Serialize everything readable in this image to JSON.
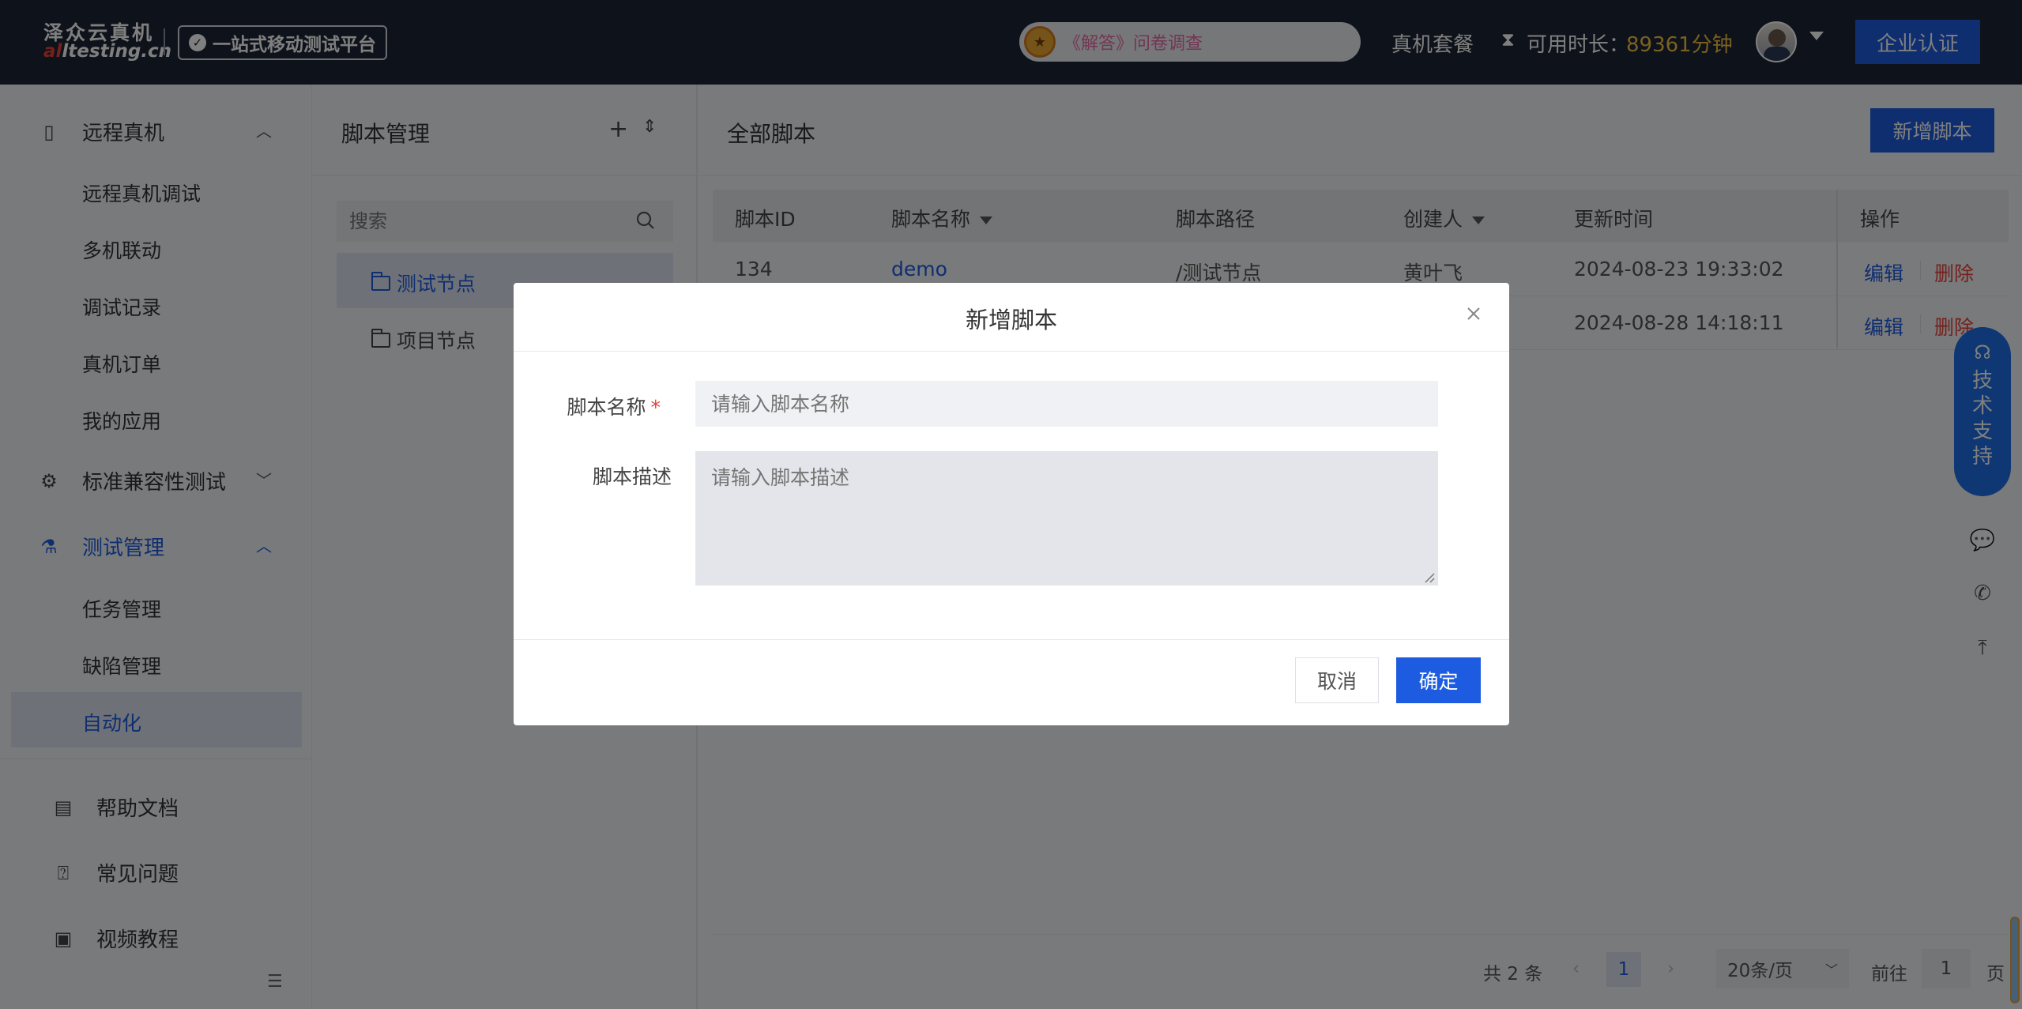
{
  "header": {
    "logo_main": "泽众云真机",
    "logo_sub_prefix": "al",
    "logo_sub_rest": "ltesting.cn",
    "slogan": "一站式移动测试平台",
    "survey_text": "《解答》问卷调查",
    "nav_package": "真机套餐",
    "available_label": "可用时长：",
    "available_value": "89361分钟",
    "enterprise_btn": "企业认证"
  },
  "sidebar": {
    "groups": [
      {
        "label": "远程真机",
        "items": [
          "远程真机调试",
          "多机联动",
          "调试记录",
          "真机订单",
          "我的应用"
        ]
      },
      {
        "label": "标准兼容性测试"
      },
      {
        "label": "测试管理",
        "items": [
          "任务管理",
          "缺陷管理",
          "自动化"
        ]
      }
    ],
    "bottom": [
      "帮助文档",
      "常见问题",
      "视频教程"
    ]
  },
  "script_panel": {
    "title": "脚本管理",
    "search_placeholder": "搜索",
    "nodes": [
      "测试节点",
      "项目节点"
    ]
  },
  "main": {
    "title": "全部脚本",
    "new_btn": "新增脚本",
    "columns": [
      "脚本ID",
      "脚本名称",
      "脚本路径",
      "创建人",
      "更新时间",
      "操作"
    ],
    "rows": [
      {
        "id": "134",
        "name": "demo",
        "path": "/测试节点",
        "creator": "黄叶飞",
        "updated": "2024-08-23 19:33:02"
      },
      {
        "updated": "2024-08-28 14:18:11"
      }
    ],
    "edit": "编辑",
    "delete": "删除",
    "pager": {
      "total": "共 2 条",
      "current": "1",
      "size": "20条/页",
      "goto": "前往",
      "goto_value": "1",
      "page_suffix": "页"
    }
  },
  "support": {
    "label": "技术支持"
  },
  "modal": {
    "title": "新增脚本",
    "name_label": "脚本名称",
    "name_placeholder": "请输入脚本名称",
    "desc_label": "脚本描述",
    "desc_placeholder": "请输入脚本描述",
    "cancel": "取消",
    "confirm": "确定"
  }
}
